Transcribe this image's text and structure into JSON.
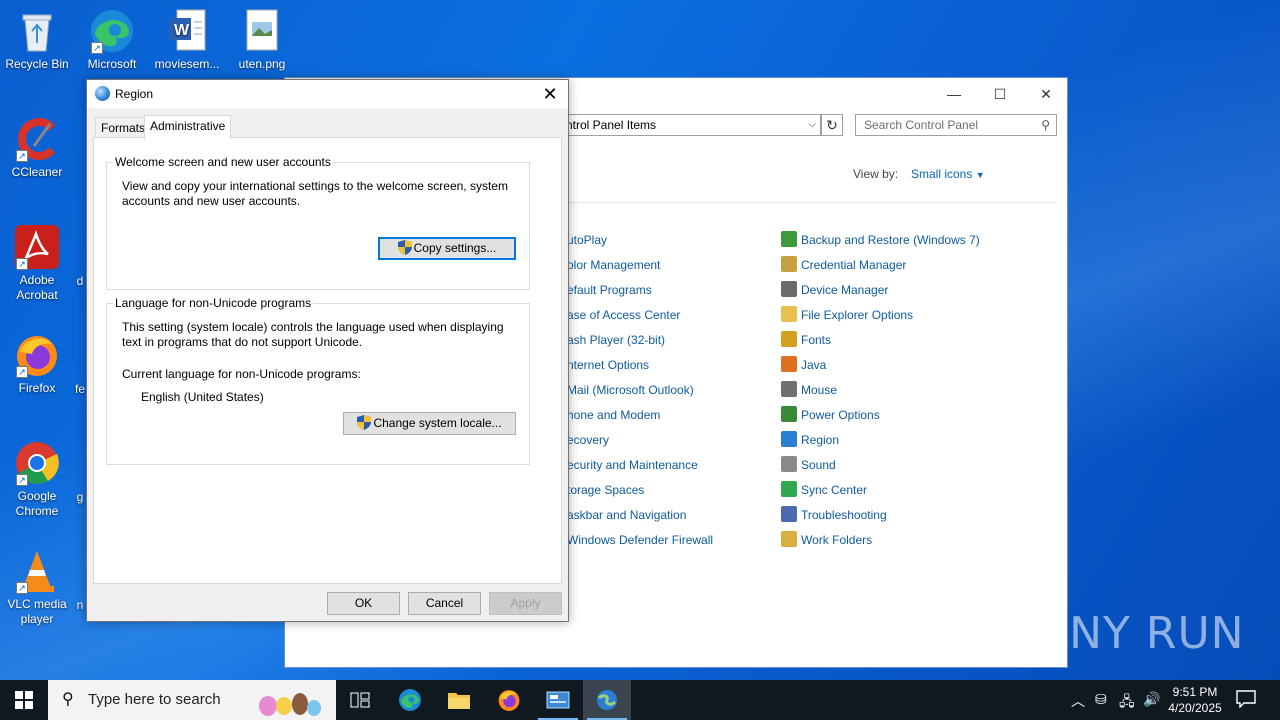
{
  "desktop": {
    "icons": [
      {
        "label": "Recycle Bin",
        "icon": "recycle-bin-icon"
      },
      {
        "label": "Microsoft Edge",
        "icon": "edge-icon"
      },
      {
        "label": "moviesem...",
        "icon": "word-doc-icon"
      },
      {
        "label": "uten.png",
        "icon": "png-file-icon"
      },
      {
        "label": "CCleaner",
        "icon": "ccleaner-icon"
      },
      {
        "label": "Adobe Acrobat",
        "icon": "acrobat-icon"
      },
      {
        "label": "Firefox",
        "icon": "firefox-icon"
      },
      {
        "label": "Google Chrome",
        "icon": "chrome-icon"
      },
      {
        "label": "VLC media player",
        "icon": "vlc-icon"
      }
    ],
    "partial_labels": [
      "d",
      "fe",
      "g",
      "n"
    ]
  },
  "control_panel": {
    "address": "ntrol Panel Items",
    "search_placeholder": "Search Control Panel",
    "view_by_label": "View by:",
    "view_by_value": "Small icons",
    "left_items": [
      "utoPlay",
      "olor Management",
      "efault Programs",
      "ase of Access Center",
      "ash Player (32-bit)",
      "nternet Options",
      "Mail (Microsoft Outlook)",
      "hone and Modem",
      "ecovery",
      "ecurity and Maintenance",
      "torage Spaces",
      "askbar and Navigation",
      "Windows Defender Firewall"
    ],
    "right_items": [
      "Backup and Restore (Windows 7)",
      "Credential Manager",
      "Device Manager",
      "File Explorer Options",
      "Fonts",
      "Java",
      "Mouse",
      "Power Options",
      "Region",
      "Sound",
      "Sync Center",
      "Troubleshooting",
      "Work Folders"
    ],
    "right_icon_colors": [
      "#3c9a3c",
      "#c8a040",
      "#6a6a6a",
      "#e8c050",
      "#d4a020",
      "#e07020",
      "#707070",
      "#3a8a3a",
      "#2a7fd4",
      "#8a8a8a",
      "#2fa84f",
      "#4a6ab0",
      "#d8b040"
    ]
  },
  "region_dialog": {
    "title": "Region",
    "tabs": [
      "Formats",
      "Administrative"
    ],
    "active_tab": "Administrative",
    "welcome_group": {
      "legend": "Welcome screen and new user accounts",
      "text_line1": "View and copy your international settings to the welcome screen, system",
      "text_line2": "accounts and new user accounts.",
      "button": "Copy settings..."
    },
    "unicode_group": {
      "legend": "Language for non-Unicode programs",
      "text_line1": "This setting (system locale) controls the language used when displaying",
      "text_line2": "text in programs that do not support Unicode.",
      "current_label": "Current language for non-Unicode programs:",
      "current_value": "English (United States)",
      "button": "Change system locale..."
    },
    "buttons": {
      "ok": "OK",
      "cancel": "Cancel",
      "apply": "Apply"
    }
  },
  "taskbar": {
    "search_placeholder": "Type here to search",
    "time": "9:51 PM",
    "date": "4/20/2025"
  },
  "watermark": "ANY RUN"
}
